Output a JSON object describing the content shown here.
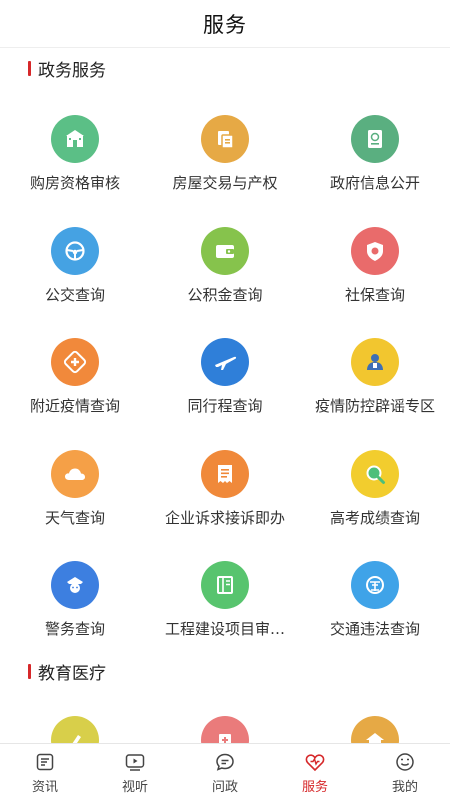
{
  "header": {
    "title": "服务"
  },
  "sections": [
    {
      "title": "政务服务",
      "items": [
        {
          "label": "购房资格审核",
          "icon": "building-icon",
          "color": "#5bbf86"
        },
        {
          "label": "房屋交易与产权",
          "icon": "document-copy-icon",
          "color": "#e6a945"
        },
        {
          "label": "政府信息公开",
          "icon": "passport-icon",
          "color": "#5aaf80"
        },
        {
          "label": "公交查询",
          "icon": "steering-wheel-icon",
          "color": "#45a2e3"
        },
        {
          "label": "公积金查询",
          "icon": "wallet-icon",
          "color": "#86c34c"
        },
        {
          "label": "社保查询",
          "icon": "shield-icon",
          "color": "#e96b6b"
        },
        {
          "label": "附近疫情查询",
          "icon": "medical-cross-icon",
          "color": "#f1893b"
        },
        {
          "label": "同行程查询",
          "icon": "airplane-icon",
          "color": "#2f7fd9"
        },
        {
          "label": "疫情防控辟谣专区",
          "icon": "person-icon",
          "color": "#f2c62f"
        },
        {
          "label": "天气查询",
          "icon": "cloud-icon",
          "color": "#f5a047"
        },
        {
          "label": "企业诉求接诉即办",
          "icon": "receipt-icon",
          "color": "#f0893a"
        },
        {
          "label": "高考成绩查询",
          "icon": "magnifier-icon",
          "color": "#f2cd2e"
        },
        {
          "label": "警务查询",
          "icon": "police-icon",
          "color": "#3d7fe0"
        },
        {
          "label": "工程建设项目审…",
          "icon": "book-icon",
          "color": "#58c46e"
        },
        {
          "label": "交通违法查询",
          "icon": "traffic-law-icon",
          "color": "#3fa3e8"
        }
      ]
    },
    {
      "title": "教育医疗",
      "items": [
        {
          "label": "",
          "icon": "edu-icon",
          "color": "#d8cf4a"
        },
        {
          "label": "",
          "icon": "hospital-icon",
          "color": "#ea7b7b"
        },
        {
          "label": "",
          "icon": "house-icon",
          "color": "#e6a945"
        }
      ]
    }
  ],
  "tabbar": {
    "items": [
      {
        "label": "资讯",
        "icon": "news-icon",
        "active": false
      },
      {
        "label": "视听",
        "icon": "video-icon",
        "active": false
      },
      {
        "label": "问政",
        "icon": "chat-icon",
        "active": false
      },
      {
        "label": "服务",
        "icon": "service-icon",
        "active": true
      },
      {
        "label": "我的",
        "icon": "smile-icon",
        "active": false
      }
    ],
    "active_color": "#d6282a"
  }
}
